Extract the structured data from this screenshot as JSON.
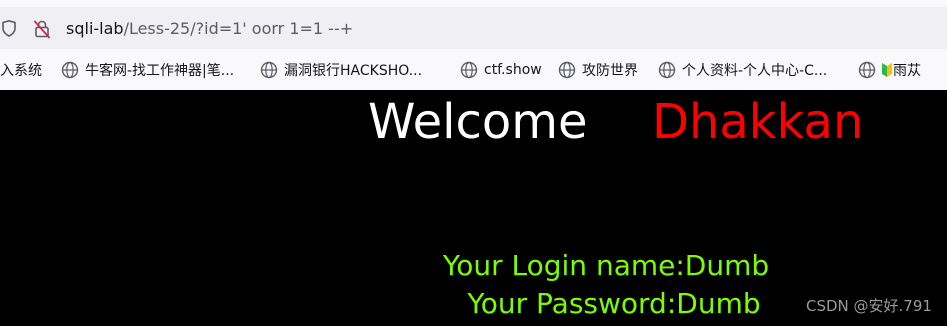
{
  "browser": {
    "url_host": "sqli-lab",
    "url_path": "/Less-25/?id=1' oorr 1=1 --+"
  },
  "bookmarks": [
    {
      "label": "入系统",
      "icon": "none"
    },
    {
      "label": "牛客网-找工作神器|笔...",
      "icon": "globe-icon"
    },
    {
      "label": "漏洞银行HACKSHO...",
      "icon": "globe-icon"
    },
    {
      "label": "ctf.show",
      "icon": "globe-icon"
    },
    {
      "label": "攻防世界",
      "icon": "globe-icon"
    },
    {
      "label": "个人资料-个人中心-C...",
      "icon": "globe-icon"
    },
    {
      "label": "雨苁",
      "icon": "globe-icon"
    }
  ],
  "page": {
    "welcome": "Welcome",
    "name_highlight": "Dhakkan",
    "login_line": "Your Login name:Dumb",
    "password_line": "Your Password:Dumb"
  },
  "watermark": "CSDN @安好.791",
  "colors": {
    "page_background": "#000000",
    "welcome": "#ffffff",
    "name_highlight": "#ff0000",
    "result_text": "#7cfc00"
  }
}
